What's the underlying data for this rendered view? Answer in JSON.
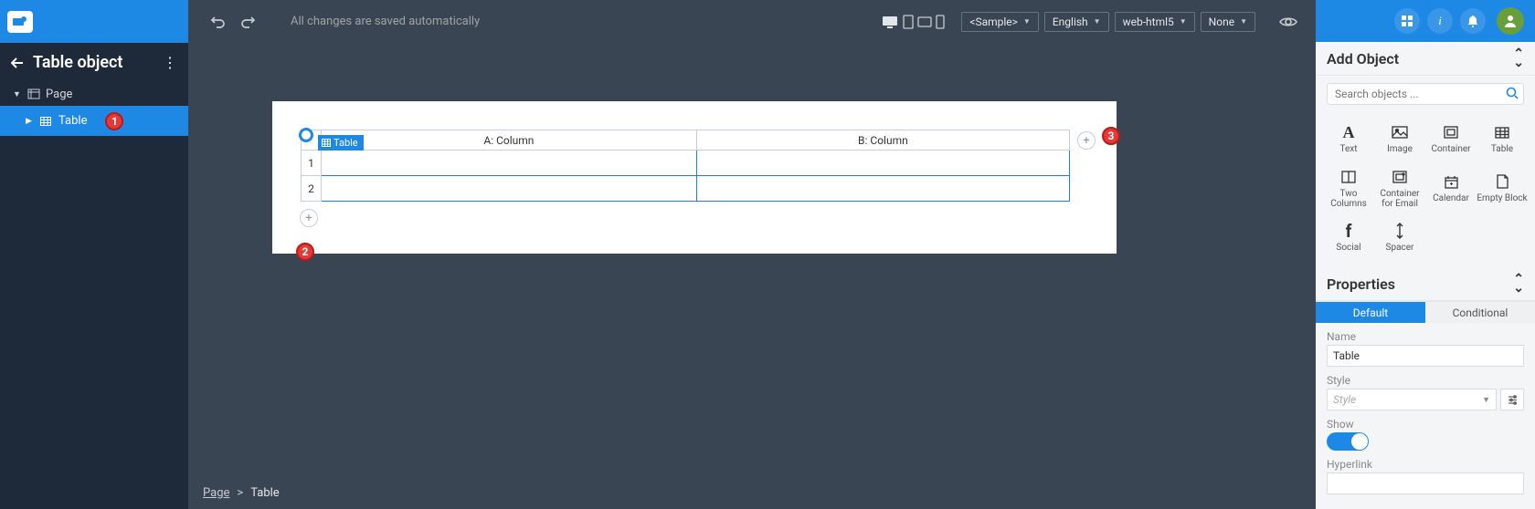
{
  "header": {
    "autosave_msg": "All changes are saved automatically",
    "selectors": {
      "sample": "<Sample>",
      "language": "English",
      "target": "web-html5",
      "theme": "None"
    }
  },
  "sidebar": {
    "title": "Table object",
    "tree": {
      "page_label": "Page",
      "table_label": "Table"
    }
  },
  "callouts": {
    "one": "1",
    "two": "2",
    "three": "3"
  },
  "canvas": {
    "table_badge": "Table",
    "columns": [
      "A: Column",
      "B: Column"
    ],
    "rows": [
      "1",
      "2"
    ]
  },
  "breadcrumb": {
    "page": "Page",
    "sep": ">",
    "current": "Table"
  },
  "right": {
    "add_object_title": "Add Object",
    "search_placeholder": "Search objects ...",
    "objects": [
      {
        "id": "text",
        "label": "Text",
        "glyph": "A"
      },
      {
        "id": "image",
        "label": "Image",
        "glyph": "img"
      },
      {
        "id": "container",
        "label": "Container",
        "glyph": "ctn"
      },
      {
        "id": "table",
        "label": "Table",
        "glyph": "tbl"
      },
      {
        "id": "two-columns",
        "label": "Two Columns",
        "glyph": "2c"
      },
      {
        "id": "container-email",
        "label": "Container for Email",
        "glyph": "ce"
      },
      {
        "id": "calendar",
        "label": "Calendar",
        "glyph": "cal"
      },
      {
        "id": "empty-block",
        "label": "Empty Block",
        "glyph": "eb"
      },
      {
        "id": "social",
        "label": "Social",
        "glyph": "f"
      },
      {
        "id": "spacer",
        "label": "Spacer",
        "glyph": "sp"
      }
    ],
    "properties_title": "Properties",
    "tabs": {
      "default": "Default",
      "conditional": "Conditional"
    },
    "props": {
      "name_label": "Name",
      "name_value": "Table",
      "style_label": "Style",
      "style_placeholder": "Style",
      "show_label": "Show",
      "hyperlink_label": "Hyperlink",
      "hyperlink_value": ""
    }
  }
}
